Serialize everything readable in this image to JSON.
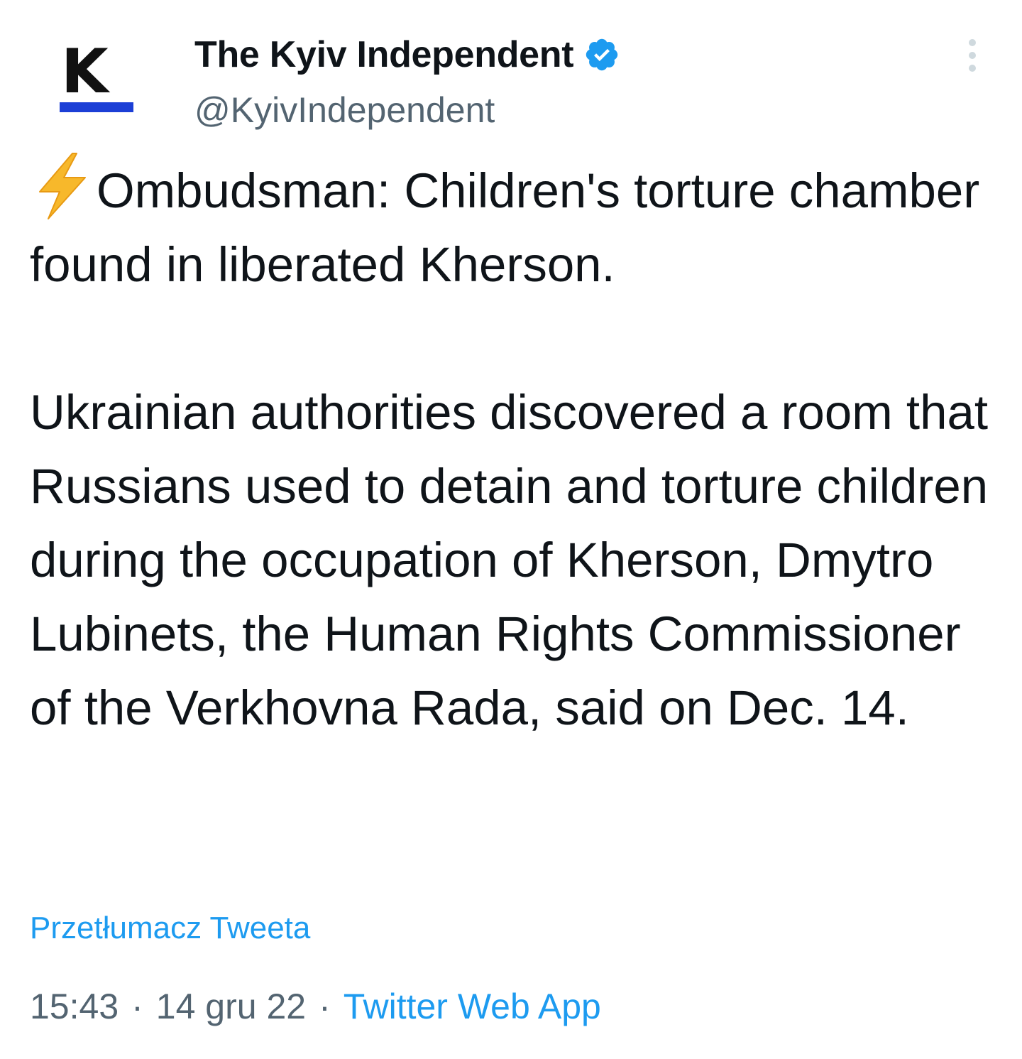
{
  "author": {
    "display_name": "The Kyiv Independent",
    "handle": "@KyivIndependent",
    "verified": true,
    "avatar_letter": "K",
    "avatar_bar_color": "#1c3fd6",
    "verified_color": "#1d9bf0"
  },
  "icons": {
    "verified": "verified-badge-icon",
    "more": "more-options-icon",
    "bolt": "high-voltage-emoji-icon"
  },
  "tweet": {
    "headline": "Ombudsman: Children's torture chamber found in liberated Kherson.",
    "body": "Ukrainian authorities discovered a room that Russians used to detain and torture children during the occupation of Kherson, Dmytro Lubinets, the Human Rights Commissioner of the Verkhovna Rada, said on Dec. 14.",
    "translate_label": "Przetłumacz Tweeta"
  },
  "meta": {
    "time": "15:43",
    "separator": "·",
    "date": "14 gru 22",
    "source": "Twitter Web App"
  },
  "colors": {
    "text": "#0f1419",
    "secondary": "#536471",
    "link": "#1d9bf0"
  }
}
